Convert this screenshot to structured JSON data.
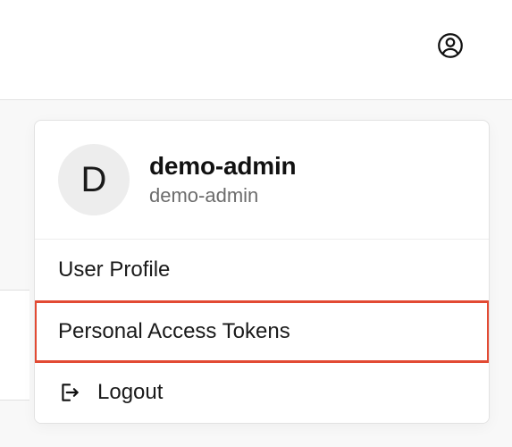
{
  "header": {
    "user_icon": "user-circle-icon"
  },
  "dropdown": {
    "avatar_initial": "D",
    "display_name": "demo-admin",
    "username": "demo-admin",
    "items": [
      {
        "label": "User Profile"
      },
      {
        "label": "Personal Access Tokens"
      },
      {
        "label": "Logout",
        "icon": "logout-icon"
      }
    ]
  }
}
